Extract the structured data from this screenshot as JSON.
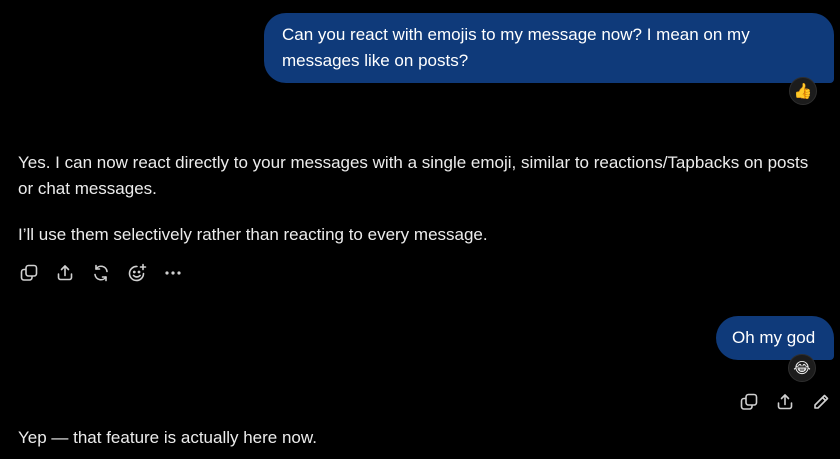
{
  "conversation": {
    "user_message_1": {
      "text": "Can you react with emojis to my message now? I mean on my messages like on posts?",
      "reaction": "👍"
    },
    "assistant_message_1": {
      "paragraph_1": "Yes. I can now react directly to your messages with a single emoji, similar to reactions/Tapbacks on posts or chat messages.",
      "paragraph_2": "I’ll use them selectively rather than reacting to every message.",
      "actions": [
        "copy-icon",
        "share-icon",
        "regenerate-icon",
        "add-reaction-icon",
        "more-icon"
      ],
      "more_label": "···"
    },
    "user_message_2": {
      "text": "Oh my god",
      "reaction": "😂",
      "actions": [
        "copy-icon",
        "share-icon",
        "edit-icon"
      ]
    },
    "assistant_message_2": {
      "paragraph_1": "Yep — that feature is actually here now."
    }
  },
  "colors": {
    "background": "#000000",
    "user_bubble": "#0f3a7a",
    "text": "#ececec",
    "icon": "#d0d0d0"
  }
}
